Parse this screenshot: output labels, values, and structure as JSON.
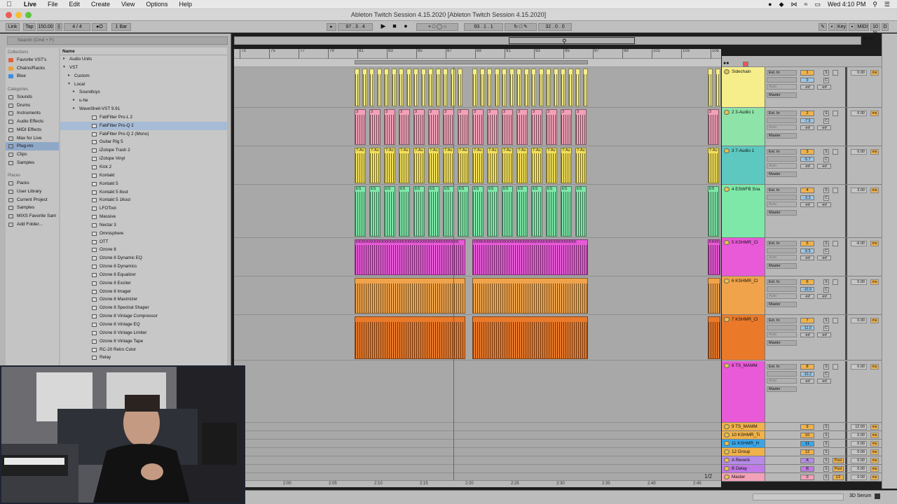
{
  "menubar": {
    "items": [
      "Live",
      "File",
      "Edit",
      "Create",
      "View",
      "Options",
      "Help"
    ],
    "clock": "Wed 4:10 PM"
  },
  "window": {
    "title": "Ableton Twitch Session 4.15.2020  [Ableton Twitch Session 4.15.2020]"
  },
  "control_bar": {
    "link": "Link",
    "tap": "Tap",
    "tempo": "150.00",
    "signature": "4 / 4",
    "quantize": "1 Bar",
    "position": "97 .  3 .  4",
    "loop_start": "93 .  1 .  1",
    "loop_length": "32 .  0 .  0",
    "key": "Key",
    "midi": "MIDI",
    "cpu": "10 %",
    "disk": "D"
  },
  "browser": {
    "search_placeholder": "Search (Cmd + F)",
    "collections_label": "Collections",
    "collections": [
      {
        "label": "Favorite VST's",
        "color": "#e0603a"
      },
      {
        "label": "Chains/Racks",
        "color": "#e8a23a"
      },
      {
        "label": "Blue",
        "color": "#3f8ee0"
      }
    ],
    "categories_label": "Categories",
    "categories": [
      "Sounds",
      "Drums",
      "Instruments",
      "Audio Effects",
      "MIDI Effects",
      "Max for Live",
      "Plug-ins",
      "Clips",
      "Samples"
    ],
    "selected_category": "Plug-ins",
    "places_label": "Places",
    "places": [
      "Packs",
      "User Library",
      "Current Project",
      "Samples",
      "MIXS Favorite Sam",
      "Add Folder..."
    ],
    "name_header": "Name",
    "tree": [
      {
        "label": "Audio Units",
        "indent": 0,
        "kind": "folder-closed"
      },
      {
        "label": "VST",
        "indent": 0,
        "kind": "folder-open"
      },
      {
        "label": "Custom",
        "indent": 1,
        "kind": "folder-closed"
      },
      {
        "label": "Local",
        "indent": 1,
        "kind": "folder-open"
      },
      {
        "label": "Soundtoys",
        "indent": 2,
        "kind": "folder-closed"
      },
      {
        "label": "u-he",
        "indent": 2,
        "kind": "folder-closed"
      },
      {
        "label": "WaveShell-VST 9.91",
        "indent": 2,
        "kind": "folder-closed"
      },
      {
        "label": "FabFilter Pro-L 2",
        "indent": 3,
        "kind": "plugin"
      },
      {
        "label": "FabFilter Pro-Q 2",
        "indent": 3,
        "kind": "plugin",
        "selected": true
      },
      {
        "label": "FabFilter Pro-Q 2 (Mono)",
        "indent": 3,
        "kind": "plugin"
      },
      {
        "label": "Guitar Rig 5",
        "indent": 3,
        "kind": "plugin"
      },
      {
        "label": "iZotope Trash 2",
        "indent": 3,
        "kind": "plugin"
      },
      {
        "label": "iZotope Vinyl",
        "indent": 3,
        "kind": "plugin"
      },
      {
        "label": "Kick 2",
        "indent": 3,
        "kind": "plugin"
      },
      {
        "label": "Kontakt",
        "indent": 3,
        "kind": "plugin"
      },
      {
        "label": "Kontakt 5",
        "indent": 3,
        "kind": "plugin"
      },
      {
        "label": "Kontakt 5 8out",
        "indent": 3,
        "kind": "plugin"
      },
      {
        "label": "Kontakt 5 16out",
        "indent": 3,
        "kind": "plugin"
      },
      {
        "label": "LFOTool",
        "indent": 3,
        "kind": "plugin"
      },
      {
        "label": "Massive",
        "indent": 3,
        "kind": "plugin"
      },
      {
        "label": "Nectar 3",
        "indent": 3,
        "kind": "plugin"
      },
      {
        "label": "Omnisphere",
        "indent": 3,
        "kind": "plugin"
      },
      {
        "label": "OTT",
        "indent": 3,
        "kind": "plugin"
      },
      {
        "label": "Ozone 8",
        "indent": 3,
        "kind": "plugin"
      },
      {
        "label": "Ozone 8 Dynamic EQ",
        "indent": 3,
        "kind": "plugin"
      },
      {
        "label": "Ozone 8 Dynamics",
        "indent": 3,
        "kind": "plugin"
      },
      {
        "label": "Ozone 8 Equalizer",
        "indent": 3,
        "kind": "plugin"
      },
      {
        "label": "Ozone 8 Exciter",
        "indent": 3,
        "kind": "plugin"
      },
      {
        "label": "Ozone 8 Imager",
        "indent": 3,
        "kind": "plugin"
      },
      {
        "label": "Ozone 8 Maximizer",
        "indent": 3,
        "kind": "plugin"
      },
      {
        "label": "Ozone 8 Spectral Shaper",
        "indent": 3,
        "kind": "plugin"
      },
      {
        "label": "Ozone 8 Vintage Compressor",
        "indent": 3,
        "kind": "plugin"
      },
      {
        "label": "Ozone 8 Vintage EQ",
        "indent": 3,
        "kind": "plugin"
      },
      {
        "label": "Ozone 8 Vintage Limiter",
        "indent": 3,
        "kind": "plugin"
      },
      {
        "label": "Ozone 8 Vintage Tape",
        "indent": 3,
        "kind": "plugin"
      },
      {
        "label": "RC-20 Retro Color",
        "indent": 3,
        "kind": "plugin"
      },
      {
        "label": "Relay",
        "indent": 3,
        "kind": "plugin"
      }
    ]
  },
  "arrangement": {
    "ruler_ticks": [
      "73",
      "75",
      "77",
      "79",
      "81",
      "83",
      "85",
      "87",
      "89",
      "91",
      "93",
      "95",
      "97",
      "99",
      "101",
      "103",
      "105"
    ],
    "time_ticks": [
      "2:00",
      "2:05",
      "2:10",
      "2:15",
      "2:20",
      "2:25",
      "2:30",
      "2:35",
      "2:40",
      "2:45"
    ],
    "page_counter": "1/2"
  },
  "tracks": [
    {
      "num": "1",
      "name": "Sidechain",
      "color": "#f6ee8a",
      "input": "Ext. In",
      "vol": "0",
      "send": "0.00",
      "clip_label": ""
    },
    {
      "num": "2",
      "name": "2 3-Audio 1",
      "color": "#f2a1b8",
      "header_color": "#8ee3a8",
      "input": "Ext. In",
      "vol": "-7.9",
      "send": "0.00",
      "clip_label": "3"
    },
    {
      "num": "3",
      "name": "3 7-Audio 1",
      "color": "#f3e05a",
      "header_color": "#5cc8c0",
      "input": "Ext. In",
      "vol": "-5.7",
      "send": "0.00",
      "clip_label": "7-Au"
    },
    {
      "num": "4",
      "name": "4 ESWFB Sna",
      "color": "#7ee8a8",
      "header_color": "#7ee8a8",
      "input": "Ext. In",
      "vol": "-3.3",
      "send": "3.00",
      "clip_label": "ES"
    },
    {
      "num": "5",
      "name": "5 KSHMR_Cl",
      "color": "#e85ad8",
      "input": "Ext. In",
      "vol": "-9.5",
      "send": "-9.00",
      "clip_label": "K"
    },
    {
      "num": "6",
      "name": "6 KSHMR_Cl",
      "color": "#f0a34a",
      "input": "Ext. In",
      "vol": "-10.9",
      "send": "0.00",
      "clip_label": ""
    },
    {
      "num": "7",
      "name": "7 KSHMR_Cl",
      "color": "#ea7a2a",
      "input": "Ext. In",
      "vol": "-11.0",
      "send": "0.00",
      "clip_label": ""
    },
    {
      "num": "8",
      "name": "8 TS_MAMM",
      "color": "#e85ad8",
      "input": "Ext. In",
      "vol": "-10.2",
      "send": "0.00",
      "clip_label": ""
    }
  ],
  "group_rows": [
    {
      "name": "9 TS_MAMM",
      "num": "9",
      "color": "#f0b24a",
      "send": "12.00",
      "route": ""
    },
    {
      "name": "10 KSHMR_Ti",
      "num": "10",
      "color": "#f0b24a",
      "send": "0.00",
      "route": ""
    },
    {
      "name": "11 KSHMR_H",
      "num": "11",
      "color": "#3aa6e8",
      "send": "0.00",
      "route": ""
    },
    {
      "name": "12 Group",
      "num": "12",
      "color": "#f0b24a",
      "send": "0.00",
      "route": ""
    },
    {
      "name": "A Reverb",
      "num": "A",
      "color": "#b58be8",
      "send": "0.00",
      "route": "Post"
    },
    {
      "name": "B Delay",
      "num": "B",
      "color": "#c07ae8",
      "send": "0.00",
      "route": "Post"
    },
    {
      "name": "Master",
      "num": "0",
      "color": "#f2a1b8",
      "send": "0.00",
      "route": "1/2"
    }
  ],
  "mixer_labels": {
    "auto": "Auto",
    "off": "Off",
    "inf": "-inf",
    "master": "Master",
    "s": "S",
    "ms": "ms",
    "c": "C"
  },
  "statusbar": {
    "device": "3D Serum"
  }
}
